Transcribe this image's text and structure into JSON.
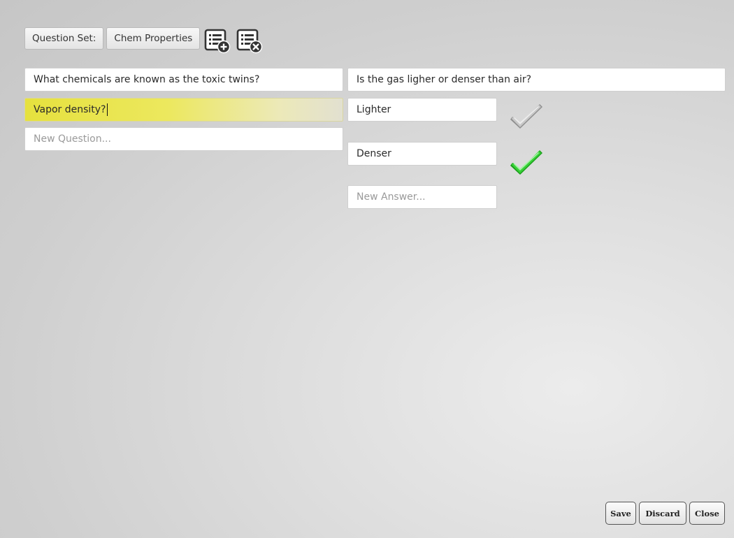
{
  "toolbar": {
    "set_label": "Question Set:",
    "set_name": "Chem Properties"
  },
  "questions": {
    "items": [
      "What chemicals are known as the toxic twins?",
      "Vapor density?"
    ],
    "new_placeholder": "New Question..."
  },
  "selected_question": {
    "text": "Is the gas ligher or denser than air?"
  },
  "answers": {
    "items": [
      {
        "text": "Lighter",
        "correct": false
      },
      {
        "text": "Denser",
        "correct": true
      }
    ],
    "new_placeholder": "New Answer..."
  },
  "actions": {
    "save": "Save",
    "discard": "Discard",
    "close": "Close"
  },
  "icons": {
    "add_set": "list-add-icon",
    "remove_set": "list-remove-icon",
    "incorrect_mark": "check-icon-gray",
    "correct_mark": "check-icon-green"
  },
  "colors": {
    "selection_highlight": "#e6e13e",
    "correct_check": "#2fc42f",
    "incorrect_check": "#a9a9a9"
  }
}
